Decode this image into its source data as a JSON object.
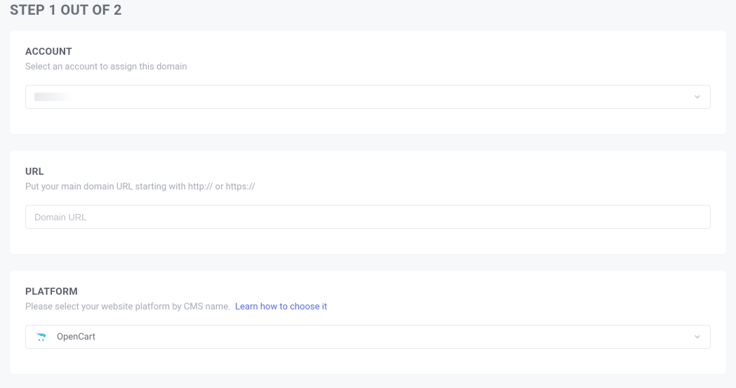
{
  "step": {
    "title": "STEP 1 OUT OF 2"
  },
  "account": {
    "label": "ACCOUNT",
    "desc": "Select an account to assign this domain",
    "selected": ""
  },
  "url": {
    "label": "URL",
    "desc": "Put your main domain URL starting with http:// or https://",
    "placeholder": "Domain URL",
    "value": ""
  },
  "platform": {
    "label": "PLATFORM",
    "desc": "Please select your website platform by CMS name.",
    "learn_link": "Learn how to choose it",
    "selected": "OpenCart"
  }
}
